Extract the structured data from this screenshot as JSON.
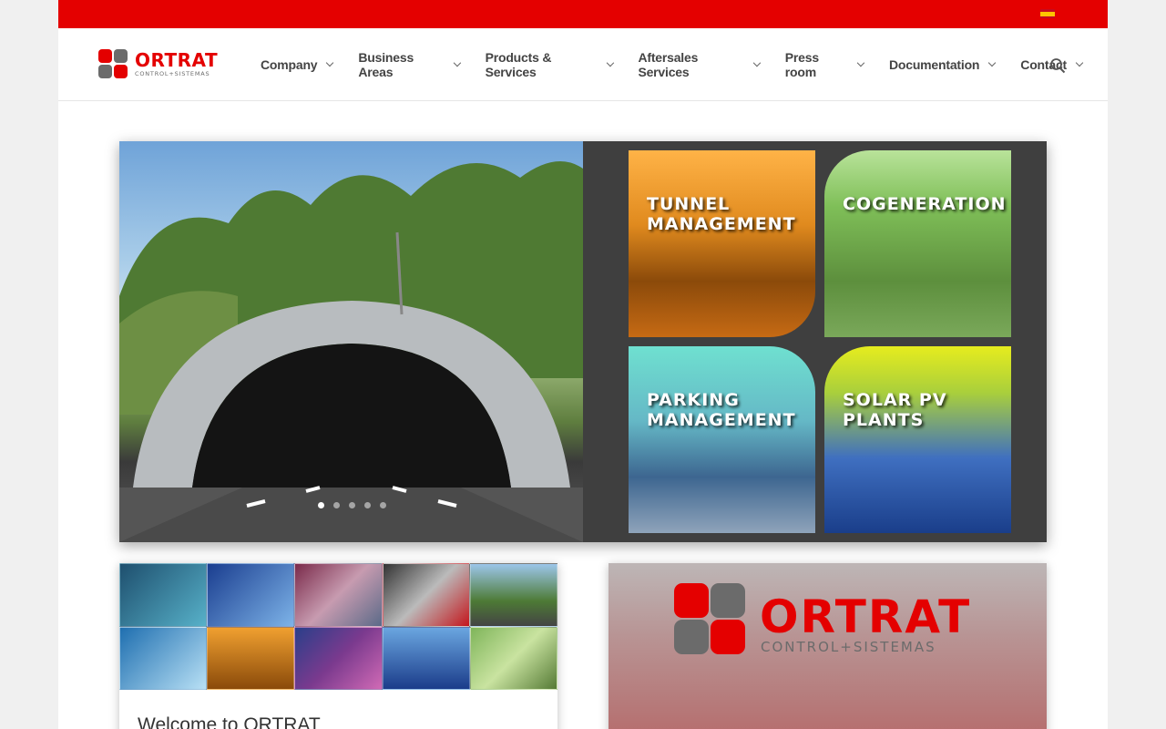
{
  "brand": {
    "name": "ORTRAT",
    "tagline": "CONTROL+SISTEMAS",
    "red": "#e40000",
    "gray": "#6b6b6b"
  },
  "topbar": {
    "language_flag": "spain-flag-icon"
  },
  "nav": {
    "items": [
      {
        "label": "Company"
      },
      {
        "label": "Business Areas"
      },
      {
        "label": "Products & Services"
      },
      {
        "label": "Aftersales Services"
      },
      {
        "label": "Press room"
      },
      {
        "label": "Documentation"
      },
      {
        "label": "Contact"
      }
    ],
    "search_icon": "search-icon"
  },
  "hero": {
    "tiles": [
      {
        "label": "TUNNEL\nMANAGEMENT"
      },
      {
        "label": "COGENERATION"
      },
      {
        "label": "PARKING\nMANAGEMENT"
      },
      {
        "label": "SOLAR PV\nPLANTS"
      }
    ],
    "slides_count": 5,
    "active_slide": 1
  },
  "welcome": {
    "title": "Welcome to ORTRAT"
  }
}
